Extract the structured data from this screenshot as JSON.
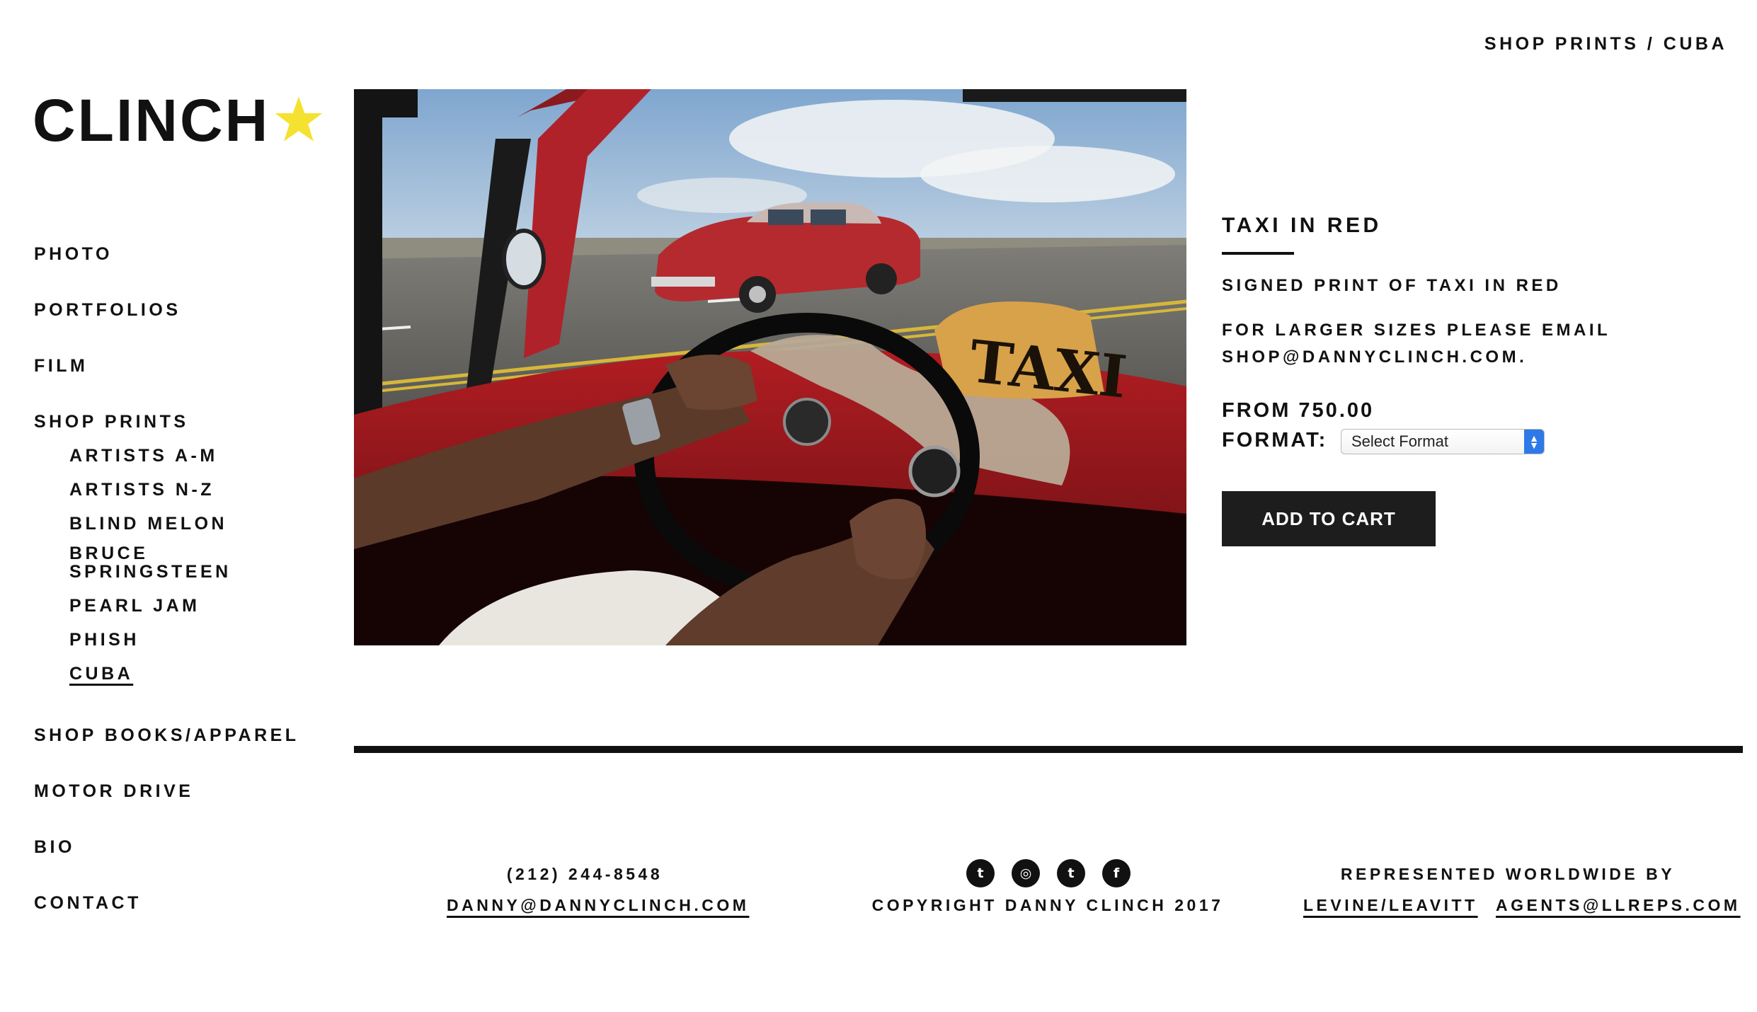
{
  "breadcrumb": "SHOP PRINTS / CUBA",
  "logo": {
    "text": "CLINCH",
    "star_color": "#f5e130"
  },
  "nav": {
    "items": [
      {
        "label": "PHOTO"
      },
      {
        "label": "PORTFOLIOS"
      },
      {
        "label": "FILM"
      },
      {
        "label": "SHOP PRINTS"
      },
      {
        "label": "SHOP BOOKS/APPAREL"
      },
      {
        "label": "MOTOR DRIVE"
      },
      {
        "label": "BIO"
      },
      {
        "label": "CONTACT"
      }
    ],
    "sub_items": [
      {
        "label": "ARTISTS A-M"
      },
      {
        "label": "ARTISTS N-Z"
      },
      {
        "label": "BLIND MELON"
      },
      {
        "label": "BRUCE SPRINGSTEEN"
      },
      {
        "label": "PEARL JAM"
      },
      {
        "label": "PHISH"
      },
      {
        "label": "CUBA",
        "active": true
      }
    ]
  },
  "photo": {
    "sign_text": "TAXI"
  },
  "product": {
    "title": "TAXI IN RED",
    "subtitle": "SIGNED PRINT OF TAXI IN RED",
    "note": "FOR LARGER SIZES PLEASE EMAIL SHOP@DANNYCLINCH.COM.",
    "price": "FROM 750.00",
    "format_label": "FORMAT:",
    "format_selected": "Select Format",
    "add_to_cart": "ADD TO CART"
  },
  "footer": {
    "phone": "(212) 244-8548",
    "email": "DANNY@DANNYCLINCH.COM",
    "copyright": "COPYRIGHT DANNY CLINCH 2017",
    "represented": "REPRESENTED WORLDWIDE BY",
    "agency": "LEVINE/LEAVITT",
    "agency_email": "AGENTS@LLREPS.COM",
    "social": [
      {
        "icon": "twitter-icon",
        "glyph": "t"
      },
      {
        "icon": "instagram-icon",
        "glyph": "◎"
      },
      {
        "icon": "tumblr-icon",
        "glyph": "t"
      },
      {
        "icon": "facebook-icon",
        "glyph": "f"
      }
    ]
  }
}
